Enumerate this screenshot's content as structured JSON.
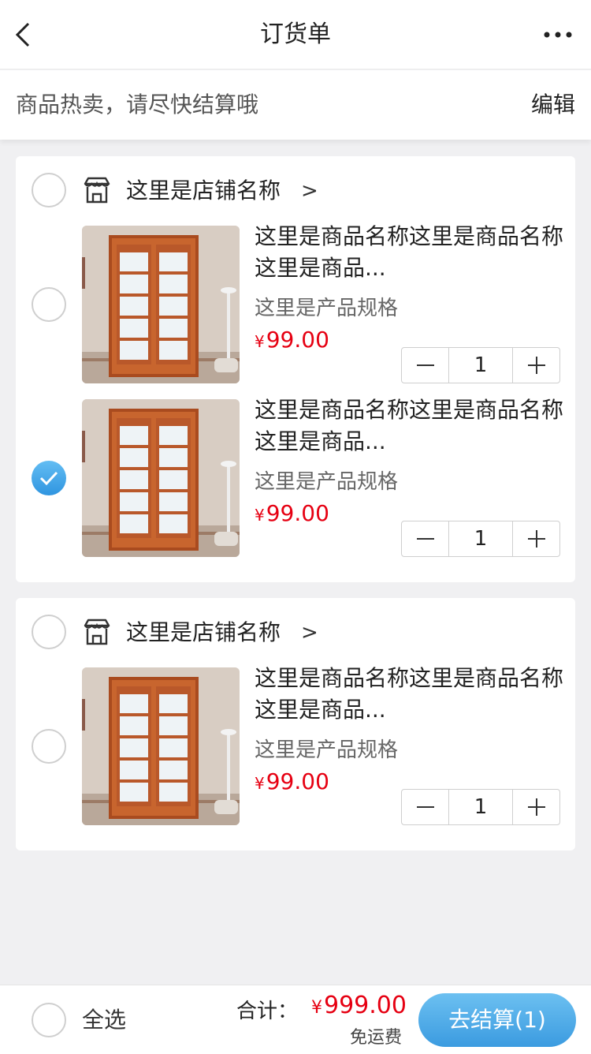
{
  "navbar": {
    "title": "订货单",
    "back_icon": "chevron-left-icon",
    "more_icon": "more-horizontal-icon"
  },
  "notice": {
    "text": "商品热卖，请尽快结算哦",
    "edit_label": "编辑"
  },
  "shops": [
    {
      "name": "这里是店铺名称",
      "arrow": ">",
      "icon": "shop-icon",
      "checked": false,
      "items": [
        {
          "name": "这里是商品名称这里是商品名称这里是商品...",
          "spec": "这里是产品规格",
          "currency": "¥",
          "price": "99.00",
          "qty": "1",
          "checked": false
        },
        {
          "name": "这里是商品名称这里是商品名称这里是商品...",
          "spec": "这里是产品规格",
          "currency": "¥",
          "price": "99.00",
          "qty": "1",
          "checked": true
        }
      ]
    },
    {
      "name": "这里是店铺名称",
      "arrow": ">",
      "icon": "shop-icon",
      "checked": false,
      "items": [
        {
          "name": "这里是商品名称这里是商品名称这里是商品...",
          "spec": "这里是产品规格",
          "currency": "¥",
          "price": "99.00",
          "qty": "1",
          "checked": false
        }
      ]
    }
  ],
  "bottom": {
    "select_all_label": "全选",
    "total_label": "合计：",
    "currency": "¥",
    "total_value": "999.00",
    "shipping": "免运费",
    "checkout_label": "去结算(1)"
  },
  "colors": {
    "price": "#e60012",
    "accent": "#3b9be0",
    "background": "#f0f0f2"
  }
}
